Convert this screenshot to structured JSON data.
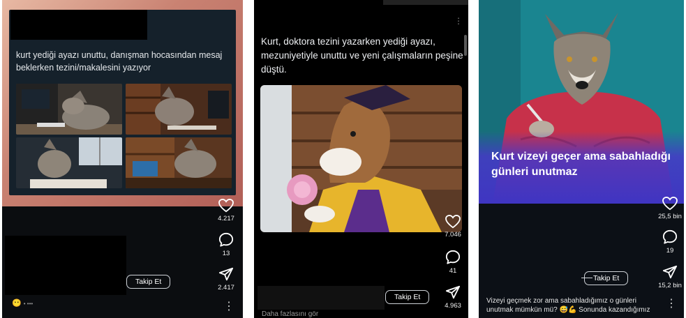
{
  "panels": [
    {
      "caption": "kurt yediği ayazı unuttu, danışman hocasından mesaj beklerken tezini/makalesini yazıyor",
      "likes": "4.217",
      "comments": "13",
      "shares": "2.417",
      "follow_label": "Takip Et",
      "emoji": "😶",
      "emoji_suffix": "• •••"
    },
    {
      "caption": "Kurt, doktora tezini yazarken yediği ayazı, mezuniyetiyle unuttu ve yeni çalışmaların peşine düştü.",
      "likes": "7.046",
      "comments": "41",
      "shares": "4.963",
      "follow_label": "Takip Et",
      "more_label": "Daha fazlasını gör"
    },
    {
      "title": "Kurt vizeyi geçer ama sabahladığı günleri unutmaz",
      "likes": "25,5 bin",
      "comments": "19",
      "shares": "15,2 bin",
      "follow_label": "Takip Et",
      "caption": "Vizeyi geçmek zor ama sabahladığımız o günleri unutmak mümkün mü? 😅💪 Sonunda kazandığımız ..."
    }
  ],
  "icons": {
    "like": "heart-icon",
    "comment": "comment-bubble-icon",
    "share": "send-icon",
    "more": "vertical-dots-icon"
  },
  "colors": {
    "dark_bg": "#0b0d10",
    "overlay_purple": "#3f35c2",
    "teal_bg": "#17818c",
    "gown_gold": "#e7b52c"
  }
}
